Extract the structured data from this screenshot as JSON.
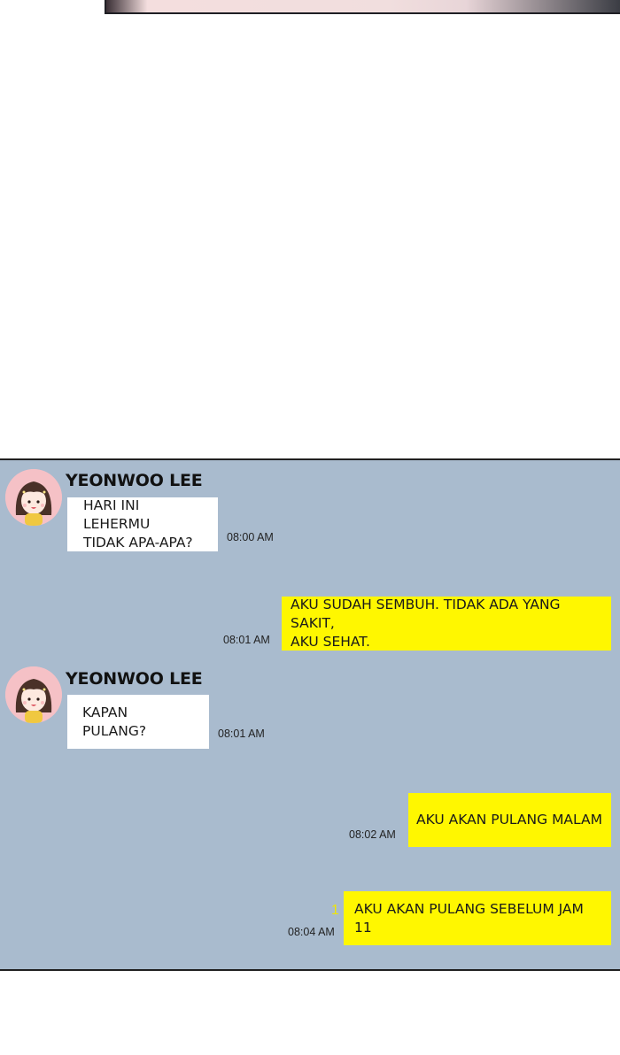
{
  "chat": {
    "messages": [
      {
        "direction": "in",
        "sender": "YEONWOO LEE",
        "text": "HARI INI LEHERMU\nTIDAK APA-APA?",
        "time": "08:00 AM"
      },
      {
        "direction": "out",
        "text": "AKU SUDAH SEMBUH. TIDAK ADA YANG SAKIT,\nAKU SEHAT.",
        "time": "08:01 AM"
      },
      {
        "direction": "in",
        "sender": "YEONWOO LEE",
        "text": "KAPAN PULANG?",
        "time": "08:01 AM"
      },
      {
        "direction": "out",
        "text": "AKU AKAN PULANG MALAM",
        "time": "08:02 AM"
      },
      {
        "direction": "out",
        "text": "AKU AKAN PULANG SEBELUM JAM 11",
        "time": "08:04 AM",
        "unread": "1"
      }
    ]
  },
  "colors": {
    "panel_bg": "#a9bbce",
    "incoming_bubble": "#ffffff",
    "outgoing_bubble": "#fff700",
    "unread_count": "#f0e600",
    "avatar_bg": "#f5c1c6"
  }
}
